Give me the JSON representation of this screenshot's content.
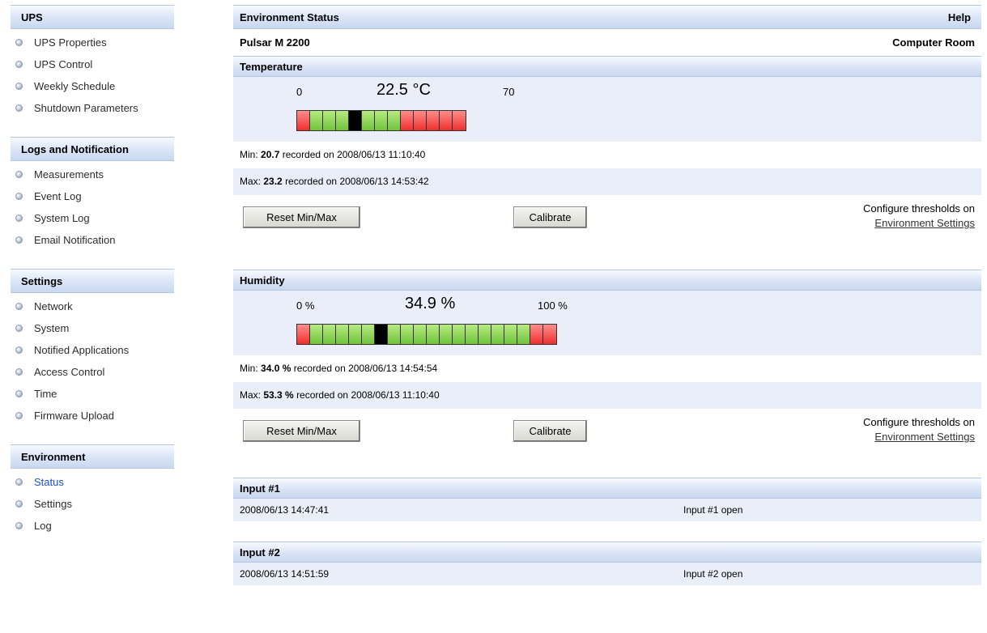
{
  "sidebar": {
    "groups": [
      {
        "title": "UPS",
        "items": [
          "UPS Properties",
          "UPS Control",
          "Weekly Schedule",
          "Shutdown Parameters"
        ]
      },
      {
        "title": "Logs and Notification",
        "items": [
          "Measurements",
          "Event Log",
          "System Log",
          "Email Notification"
        ]
      },
      {
        "title": "Settings",
        "items": [
          "Network",
          "System",
          "Notified Applications",
          "Access Control",
          "Time",
          "Firmware Upload"
        ]
      },
      {
        "title": "Environment",
        "items": [
          "Status",
          "Settings",
          "Log"
        ],
        "active_item": "Status"
      }
    ]
  },
  "page": {
    "title": "Environment Status",
    "help": "Help",
    "device": "Pulsar M 2200",
    "location": "Computer Room"
  },
  "temperature": {
    "title": "Temperature",
    "min_scale": "0",
    "value": "22.5 °C",
    "max_scale": "70",
    "gauge": [
      "red",
      "green",
      "green",
      "green",
      "black",
      "green",
      "green",
      "green",
      "red",
      "red",
      "red",
      "red",
      "red"
    ],
    "min_prefix": "Min:",
    "min_value": "20.7",
    "min_suffix": "recorded on 2008/06/13 11:10:40",
    "max_prefix": "Max:",
    "max_value": "23.2",
    "max_suffix": "recorded on 2008/06/13 14:53:42",
    "reset_label": "Reset Min/Max",
    "calibrate_label": "Calibrate",
    "config_text": "Configure thresholds on",
    "config_link": "Environment Settings"
  },
  "humidity": {
    "title": "Humidity",
    "min_scale": "0 %",
    "value": "34.9 %",
    "max_scale": "100 %",
    "gauge": [
      "red",
      "green",
      "green",
      "green",
      "green",
      "green",
      "black",
      "green",
      "green",
      "green",
      "green",
      "green",
      "green",
      "green",
      "green",
      "green",
      "green",
      "green",
      "red",
      "red"
    ],
    "min_prefix": "Min:",
    "min_value": "34.0 %",
    "min_suffix": "recorded on 2008/06/13 14:54:54",
    "max_prefix": "Max:",
    "max_value": "53.3 %",
    "max_suffix": "recorded on 2008/06/13 11:10:40",
    "reset_label": "Reset Min/Max",
    "calibrate_label": "Calibrate",
    "config_text": "Configure thresholds on",
    "config_link": "Environment Settings"
  },
  "inputs": [
    {
      "title": "Input #1",
      "time": "2008/06/13 14:47:41",
      "status": "Input #1 open"
    },
    {
      "title": "Input #2",
      "time": "2008/06/13 14:51:59",
      "status": "Input #2 open"
    }
  ],
  "colors": {
    "header_bg": "#d9e4f6",
    "row_bg": "#e9eef9",
    "active_link": "#1b4fd1",
    "gauge_red": "#f02d2d",
    "gauge_green": "#6fc43a"
  }
}
